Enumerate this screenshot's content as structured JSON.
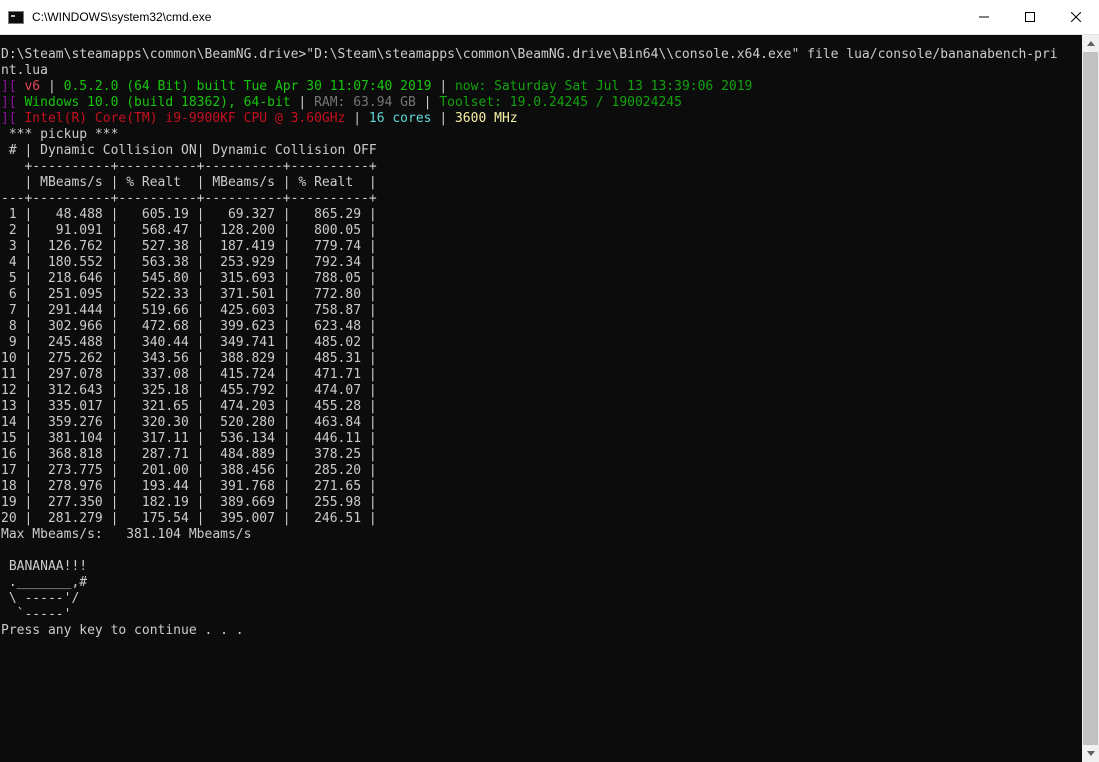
{
  "window": {
    "title": "C:\\WINDOWS\\system32\\cmd.exe",
    "minimize_symbol": "minimize-icon",
    "maximize_symbol": "maximize-icon",
    "close_symbol": "close-icon"
  },
  "console": {
    "command_line_1": "D:\\Steam\\steamapps\\common\\BeamNG.drive>\"D:\\Steam\\steamapps\\common\\BeamNG.drive\\Bin64\\\\console.x64.exe\" file lua/console/bananabench-pri",
    "command_line_2": "nt.lua",
    "bracket": "][",
    "sep": "|",
    "version": "v6",
    "build": "0.5.2.0 (64 Bit) built Tue Apr 30 11:07:40 2019",
    "now": "now: Saturday Sat Jul 13 13:39:06 2019",
    "os": "Windows 10.0 (build 18362), 64-bit",
    "ram": "RAM: 63.94 GB",
    "toolset": "Toolset: 19.0.24245 / 190024245",
    "cpu": "Intel(R) Core(TM) i9-9900KF CPU @ 3.60GHz",
    "cores": "16 cores",
    "mhz": "3600 MHz",
    "vehicle": " *** pickup ***",
    "table_header": " # | Dynamic Collision ON| Dynamic Collision OFF",
    "table_rule_1": "   +----------+----------+----------+----------+",
    "table_subheader": "   | MBeams/s | % Realt  | MBeams/s | % Realt  |",
    "table_rule_2": "---+----------+----------+----------+----------+",
    "rows": [
      " 1 |   48.488 |   605.19 |   69.327 |   865.29 |",
      " 2 |   91.091 |   568.47 |  128.200 |   800.05 |",
      " 3 |  126.762 |   527.38 |  187.419 |   779.74 |",
      " 4 |  180.552 |   563.38 |  253.929 |   792.34 |",
      " 5 |  218.646 |   545.80 |  315.693 |   788.05 |",
      " 6 |  251.095 |   522.33 |  371.501 |   772.80 |",
      " 7 |  291.444 |   519.66 |  425.603 |   758.87 |",
      " 8 |  302.966 |   472.68 |  399.623 |   623.48 |",
      " 9 |  245.488 |   340.44 |  349.741 |   485.02 |",
      "10 |  275.262 |   343.56 |  388.829 |   485.31 |",
      "11 |  297.078 |   337.08 |  415.724 |   471.71 |",
      "12 |  312.643 |   325.18 |  455.792 |   474.07 |",
      "13 |  335.017 |   321.65 |  474.203 |   455.28 |",
      "14 |  359.276 |   320.30 |  520.280 |   463.84 |",
      "15 |  381.104 |   317.11 |  536.134 |   446.11 |",
      "16 |  368.818 |   287.71 |  484.889 |   378.25 |",
      "17 |  273.775 |   201.00 |  388.456 |   285.20 |",
      "18 |  278.976 |   193.44 |  391.768 |   271.65 |",
      "19 |  277.350 |   182.19 |  389.669 |   255.98 |",
      "20 |  281.279 |   175.54 |  395.007 |   246.51 |"
    ],
    "max": "Max Mbeams/s:   381.104 Mbeams/s",
    "blank": "",
    "banana": [
      " BANANAA!!!",
      " ._______,#",
      " \\ -----'/",
      "  `-----'"
    ],
    "prompt": "Press any key to continue . . ."
  }
}
